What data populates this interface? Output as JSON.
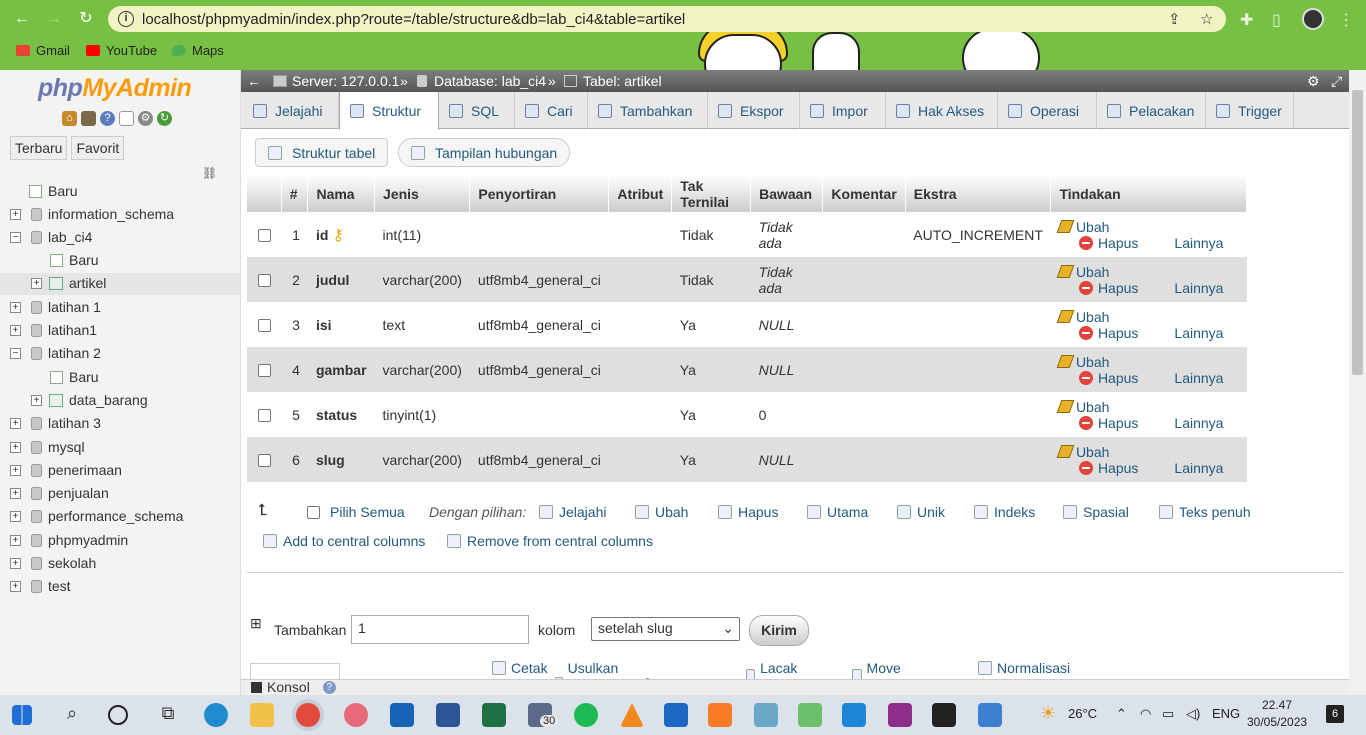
{
  "browser": {
    "url": "localhost/phpmyadmin/index.php?route=/table/structure&db=lab_ci4&table=artikel",
    "bookmarks": [
      "Gmail",
      "YouTube",
      "Maps"
    ]
  },
  "sidebar": {
    "logo_php": "php",
    "logo_myadmin": "MyAdmin",
    "tabs": [
      "Terbaru",
      "Favorit"
    ],
    "tree": [
      {
        "label": "Baru",
        "depth": 0,
        "kind": "new"
      },
      {
        "label": "information_schema",
        "depth": 0,
        "kind": "db"
      },
      {
        "label": "lab_ci4",
        "depth": 0,
        "kind": "db",
        "expanded": true
      },
      {
        "label": "Baru",
        "depth": 1,
        "kind": "new"
      },
      {
        "label": "artikel",
        "depth": 1,
        "kind": "table",
        "selected": true
      },
      {
        "label": "latihan 1",
        "depth": 0,
        "kind": "db"
      },
      {
        "label": "latihan1",
        "depth": 0,
        "kind": "db"
      },
      {
        "label": "latihan 2",
        "depth": 0,
        "kind": "db",
        "expanded": true
      },
      {
        "label": "Baru",
        "depth": 1,
        "kind": "new"
      },
      {
        "label": "data_barang",
        "depth": 1,
        "kind": "table"
      },
      {
        "label": "latihan 3",
        "depth": 0,
        "kind": "db"
      },
      {
        "label": "mysql",
        "depth": 0,
        "kind": "db"
      },
      {
        "label": "penerimaan",
        "depth": 0,
        "kind": "db"
      },
      {
        "label": "penjualan",
        "depth": 0,
        "kind": "db"
      },
      {
        "label": "performance_schema",
        "depth": 0,
        "kind": "db"
      },
      {
        "label": "phpmyadmin",
        "depth": 0,
        "kind": "db"
      },
      {
        "label": "sekolah",
        "depth": 0,
        "kind": "db"
      },
      {
        "label": "test",
        "depth": 0,
        "kind": "db"
      }
    ]
  },
  "breadcrumb": {
    "server": "Server: 127.0.0.1",
    "database": "Database: lab_ci4",
    "table": "Tabel: artikel"
  },
  "tabs": [
    "Jelajahi",
    "Struktur",
    "SQL",
    "Cari",
    "Tambahkan",
    "Ekspor",
    "Impor",
    "Hak Akses",
    "Operasi",
    "Pelacakan",
    "Trigger"
  ],
  "active_tab": "Struktur",
  "subtabs": [
    "Struktur tabel",
    "Tampilan hubungan"
  ],
  "table": {
    "headers": [
      "#",
      "Nama",
      "Jenis",
      "Penyortiran",
      "Atribut",
      "Tak Ternilai",
      "Bawaan",
      "Komentar",
      "Ekstra",
      "Tindakan"
    ],
    "rows": [
      {
        "num": "1",
        "name": "id",
        "type": "int(11)",
        "collation": "",
        "attr": "",
        "null": "Tidak",
        "default": "Tidak ada",
        "comment": "",
        "extra": "AUTO_INCREMENT",
        "primary": true
      },
      {
        "num": "2",
        "name": "judul",
        "type": "varchar(200)",
        "collation": "utf8mb4_general_ci",
        "attr": "",
        "null": "Tidak",
        "default": "Tidak ada",
        "comment": "",
        "extra": ""
      },
      {
        "num": "3",
        "name": "isi",
        "type": "text",
        "collation": "utf8mb4_general_ci",
        "attr": "",
        "null": "Ya",
        "default": "NULL",
        "comment": "",
        "extra": ""
      },
      {
        "num": "4",
        "name": "gambar",
        "type": "varchar(200)",
        "collation": "utf8mb4_general_ci",
        "attr": "",
        "null": "Ya",
        "default": "NULL",
        "comment": "",
        "extra": ""
      },
      {
        "num": "5",
        "name": "status",
        "type": "tinyint(1)",
        "collation": "",
        "attr": "",
        "null": "Ya",
        "default": "0",
        "comment": "",
        "extra": ""
      },
      {
        "num": "6",
        "name": "slug",
        "type": "varchar(200)",
        "collation": "utf8mb4_general_ci",
        "attr": "",
        "null": "Ya",
        "default": "NULL",
        "comment": "",
        "extra": ""
      }
    ],
    "actions": {
      "edit": "Ubah",
      "delete": "Hapus",
      "more": "Lainnya"
    }
  },
  "bulk": {
    "select_all": "Pilih Semua",
    "with_selected": "Dengan pilihan:",
    "items": [
      "Jelajahi",
      "Ubah",
      "Hapus",
      "Utama",
      "Unik",
      "Indeks",
      "Spasial",
      "Teks penuh"
    ],
    "add_central": "Add to central columns",
    "remove_central": "Remove from central columns"
  },
  "tools": [
    "Cetak",
    "Usulkan struktur tabel",
    "Lacak tabel",
    "Move columns",
    "Normalisasi"
  ],
  "add_form": {
    "label": "Tambahkan",
    "count": "1",
    "unit": "kolom",
    "position": "setelah slug",
    "submit": "Kirim"
  },
  "console": {
    "label": "Konsol"
  },
  "taskbar": {
    "weather": "26°C",
    "lang": "ENG",
    "time": "22.47",
    "date": "30/05/2023",
    "mail_badge": "30",
    "notif": "6"
  }
}
